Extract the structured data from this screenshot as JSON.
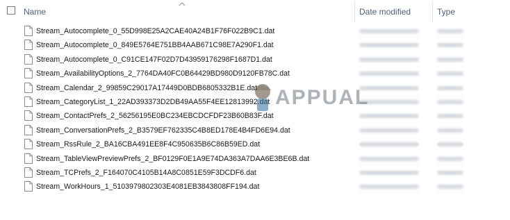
{
  "header": {
    "name_label": "Name",
    "date_label": "Date modified",
    "type_label": "Type"
  },
  "files": [
    {
      "name": "Stream_Autocomplete_0_55D998E25A2CAE40A24B1F76F022B9C1.dat"
    },
    {
      "name": "Stream_Autocomplete_0_849E5764E751BB4AAB671C98E7A290F1.dat"
    },
    {
      "name": "Stream_Autocomplete_0_C91CE147F02D7D43959176298F1687D1.dat"
    },
    {
      "name": "Stream_AvailabilityOptions_2_7764DA40FC0B64429BD980D9120FB78C.dat"
    },
    {
      "name": "Stream_Calendar_2_99859C29017A17449D0BDB6805332B1E.dat"
    },
    {
      "name": "Stream_CategoryList_1_22AD393373D2DB49AA55F4EE12813992.dat"
    },
    {
      "name": "Stream_ContactPrefs_2_56256195E0BC234EBCDCFDF23B60B83F.dat"
    },
    {
      "name": "Stream_ConversationPrefs_2_B3579EF762335C4B8ED178E4B4FD6E94.dat"
    },
    {
      "name": "Stream_RssRule_2_BA16CBA491EE8F4C950635B6C86B59ED.dat"
    },
    {
      "name": "Stream_TableViewPreviewPrefs_2_BF0129F0E1A9E74DA363A7DAA6E3BE6B.dat"
    },
    {
      "name": "Stream_TCPrefs_2_F164070C4105B14A8C0851E59F3DCDF6.dat"
    },
    {
      "name": "Stream_WorkHours_1_5103979802303E4081EB3843808FF194.dat"
    }
  ],
  "watermark": {
    "text": "APPUALS"
  },
  "icons": {
    "file": "file-icon",
    "sort": "sort-ascending-icon",
    "checkbox": "select-all-checkbox"
  },
  "colors": {
    "header_text": "#4c607a",
    "file_text": "#1a1a1a"
  }
}
